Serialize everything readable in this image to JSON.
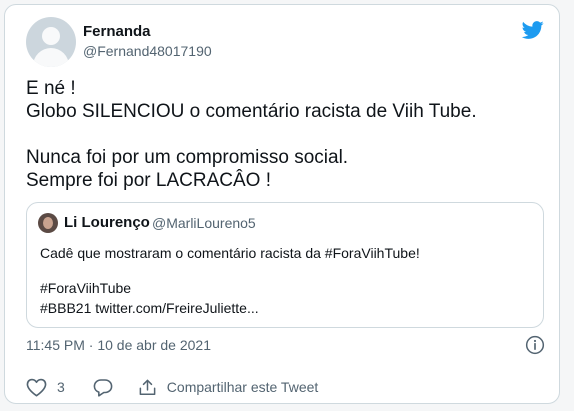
{
  "tweet": {
    "author": {
      "name": "Fernanda",
      "handle": "@Fernand48017190"
    },
    "lines": [
      "E né !",
      "Globo SILENCIOU o comentário racista de Viih Tube.",
      "",
      "Nunca foi por um compromisso social.",
      "Sempre foi por LACRACÂO !"
    ],
    "timestamp": "11:45 PM · 10 de abr de 2021",
    "likes": "3",
    "share_label": "Compartilhar este Tweet"
  },
  "quoted": {
    "author": {
      "name": "Li Lourenço",
      "handle": "@MarliLoureno5"
    },
    "lines": [
      "Cadê que mostraram o comentário racista da #ForaViihTube!",
      "",
      "#ForaViihTube",
      "#BBB21 twitter.com/FreireJuliette..."
    ]
  },
  "icons": {
    "logo": "twitter-bird-icon",
    "info": "info-icon",
    "like": "heart-icon",
    "reply": "reply-bubble-icon",
    "share": "share-icon"
  },
  "colors": {
    "brand": "#1d9bf0",
    "text": "#0f1419",
    "secondary": "#536471",
    "border": "#cfd9de"
  }
}
